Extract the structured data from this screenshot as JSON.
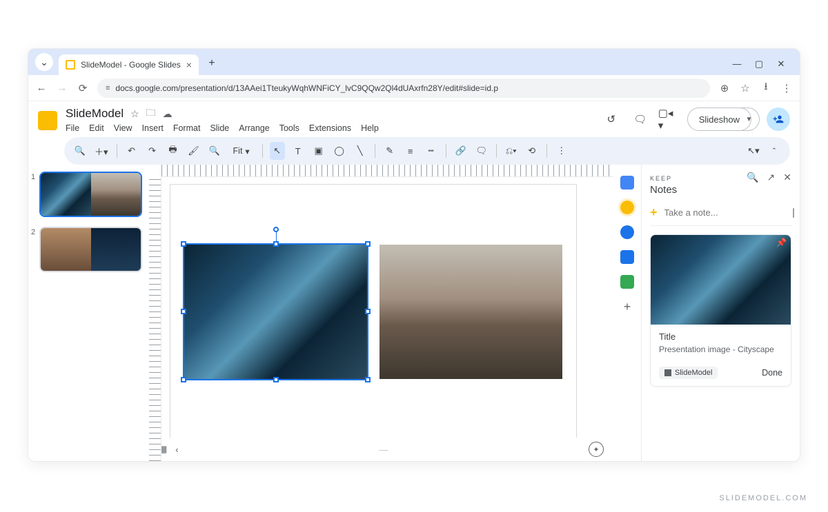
{
  "browser": {
    "tab_title": "SlideModel - Google Slides",
    "url": "docs.google.com/presentation/d/13AAei1TteukyWqhWNFiCY_lvC9QQw2Ql4dUAxrfn28Y/edit#slide=id.p"
  },
  "app": {
    "doc_title": "SlideModel",
    "menus": {
      "file": "File",
      "edit": "Edit",
      "view": "View",
      "insert": "Insert",
      "format": "Format",
      "slide": "Slide",
      "arrange": "Arrange",
      "tools": "Tools",
      "extensions": "Extensions",
      "help": "Help"
    },
    "slideshow_label": "Slideshow",
    "zoom_label": "Fit"
  },
  "thumbnails": [
    {
      "n": "1",
      "active": true
    },
    {
      "n": "2",
      "active": false
    }
  ],
  "keep": {
    "eyebrow": "KEEP",
    "title": "Notes",
    "take_note_placeholder": "Take a note...",
    "note": {
      "title": "Title",
      "desc": "Presentation image - Cityscape",
      "source": "SlideModel",
      "done": "Done"
    }
  },
  "watermark": "SLIDEMODEL.COM"
}
